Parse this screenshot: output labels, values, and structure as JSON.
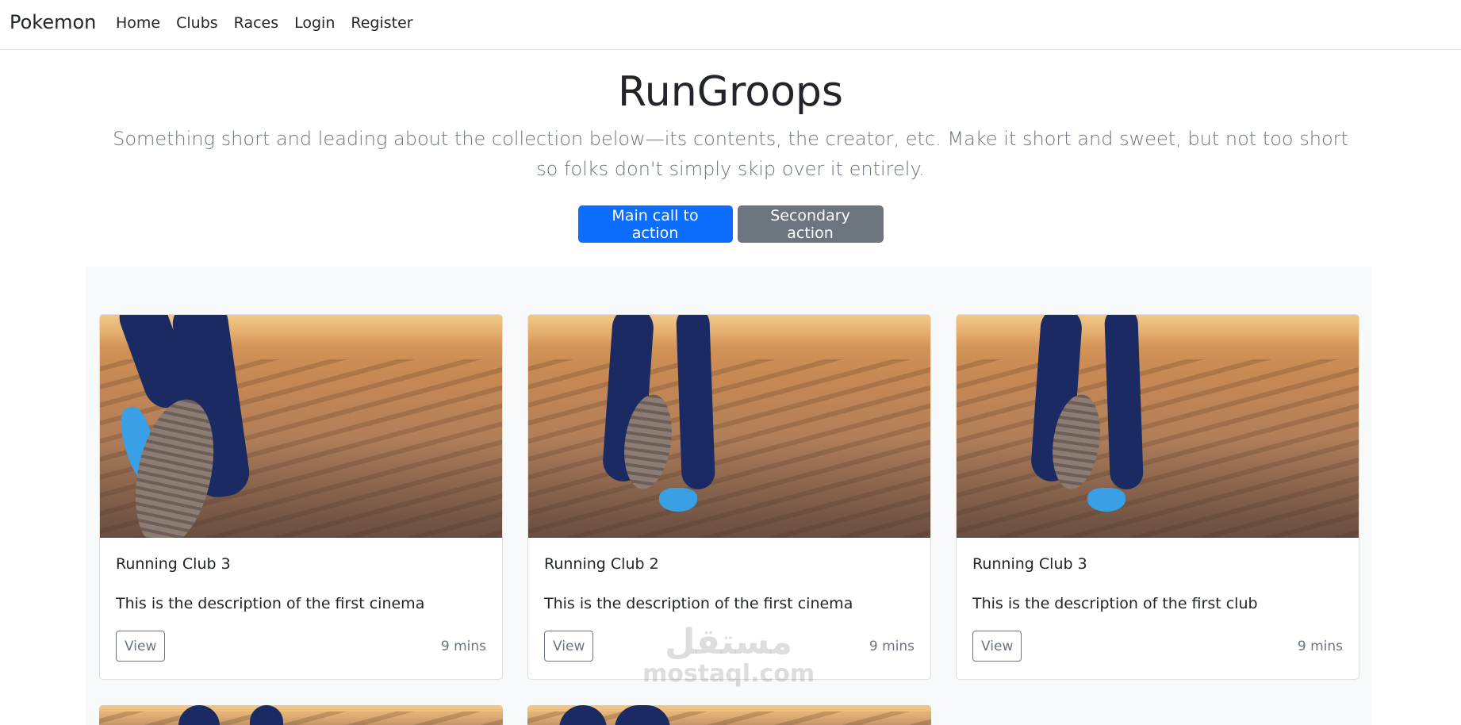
{
  "navbar": {
    "brand": "Pokemon",
    "links": [
      "Home",
      "Clubs",
      "Races",
      "Login",
      "Register"
    ]
  },
  "hero": {
    "title": "RunGroops",
    "lead": "Something short and leading about the collection below—its contents, the creator, etc. Make it short and sweet, but not too short so folks don't simply skip over it entirely.",
    "primary_button": "Main call to action",
    "secondary_button": "Secondary action"
  },
  "cards": [
    {
      "title": "Running Club 3",
      "description": "This is the description of the first cinema",
      "button": "View",
      "time": "9 mins"
    },
    {
      "title": "Running Club 2",
      "description": "This is the description of the first cinema",
      "button": "View",
      "time": "9 mins"
    },
    {
      "title": "Running Club 3",
      "description": "This is the description of the first club",
      "button": "View",
      "time": "9 mins"
    }
  ],
  "watermark": {
    "main": "مستقل",
    "sub": "mostaql.com"
  },
  "colors": {
    "primary": "#0d6efd",
    "secondary": "#6c757d",
    "album_bg": "#f8f9fa",
    "leggings": "#1c2a63",
    "shoe": "#3aa0e6"
  }
}
